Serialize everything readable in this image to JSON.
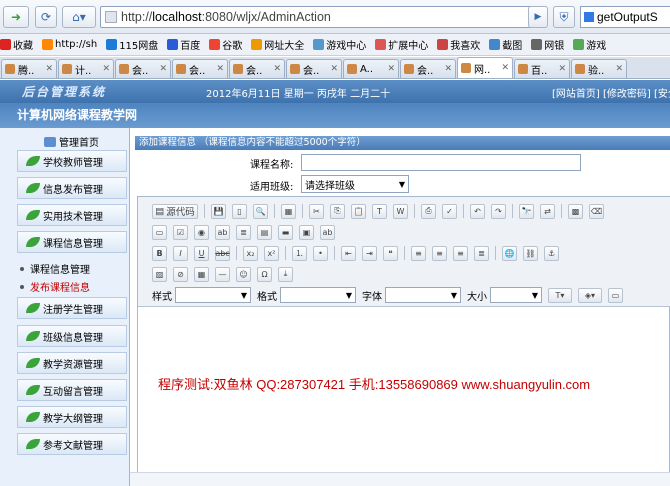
{
  "browser": {
    "url_prefix": "http://",
    "url_host": "localhost",
    "url_rest": ":8080/wljx/AdminAction",
    "search_text": "getOutputS",
    "bookmarks": [
      "收藏",
      "http://sh",
      "115网盘",
      "百度",
      "谷歌",
      "网址大全",
      "游戏中心",
      "扩展中心",
      "我喜欢",
      "截图",
      "网银",
      "游戏"
    ],
    "tabs": [
      "腾..",
      "计..",
      "会..",
      "会..",
      "会..",
      "会..",
      "A..",
      "会..",
      "网..",
      "百..",
      "验.."
    ],
    "active_tab_index": 8
  },
  "app": {
    "logo": "后台管理系统",
    "date": "2012年6月11日 星期一 丙戌年 二月二十",
    "top_links": "[网站首页] [修改密码] [安全",
    "site_title": "计算机网络课程教学网"
  },
  "sidebar": {
    "home": "管理首页",
    "menus": [
      "学校教师管理",
      "信息发布管理",
      "实用技术管理",
      "课程信息管理"
    ],
    "subs": [
      "课程信息管理",
      "发布课程信息"
    ],
    "menus2": [
      "注册学生管理",
      "班级信息管理",
      "教学资源管理",
      "互动留言管理",
      "教学大纲管理",
      "参考文献管理"
    ]
  },
  "form": {
    "panel_title": "添加课程信息 （课程信息内容不能超过5000个字符）",
    "name_label": "课程名称:",
    "class_label": "适用班级:",
    "class_selected": "请选择班级"
  },
  "editor": {
    "source_btn": "源代码",
    "style_label": "样式",
    "format_label": "格式",
    "font_label": "字体",
    "size_label": "大小",
    "content": "程序测试:双鱼林 QQ:287307421 手机:13558690869 www.shuangyulin.com"
  },
  "colors": {
    "header_blue": "#3e72ad",
    "content_red": "#c40000",
    "sub_active": "#c00000"
  }
}
